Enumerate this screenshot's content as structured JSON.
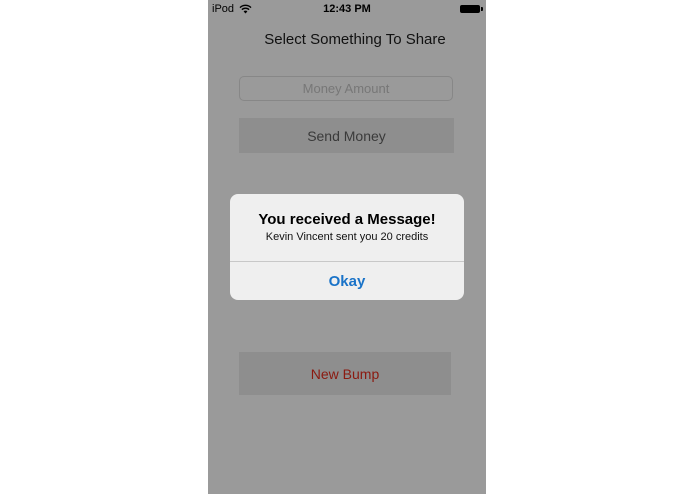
{
  "status_bar": {
    "carrier": "iPod",
    "time": "12:43 PM",
    "wifi_icon": "wifi-icon",
    "battery_icon": "battery-icon"
  },
  "screen": {
    "title": "Select Something To Share",
    "money_input": {
      "value": "",
      "placeholder": "Money Amount"
    },
    "send_button_label": "Send Money",
    "new_bump_label": "New Bump"
  },
  "alert": {
    "title": "You received a Message!",
    "message": "Kevin Vincent sent you 20 credits",
    "button_label": "Okay"
  },
  "colors": {
    "dim_overlay": "#9a9a9a",
    "alert_background": "#efefef",
    "alert_button_text": "#1a73c8",
    "new_bump_text": "#8b1a10"
  }
}
